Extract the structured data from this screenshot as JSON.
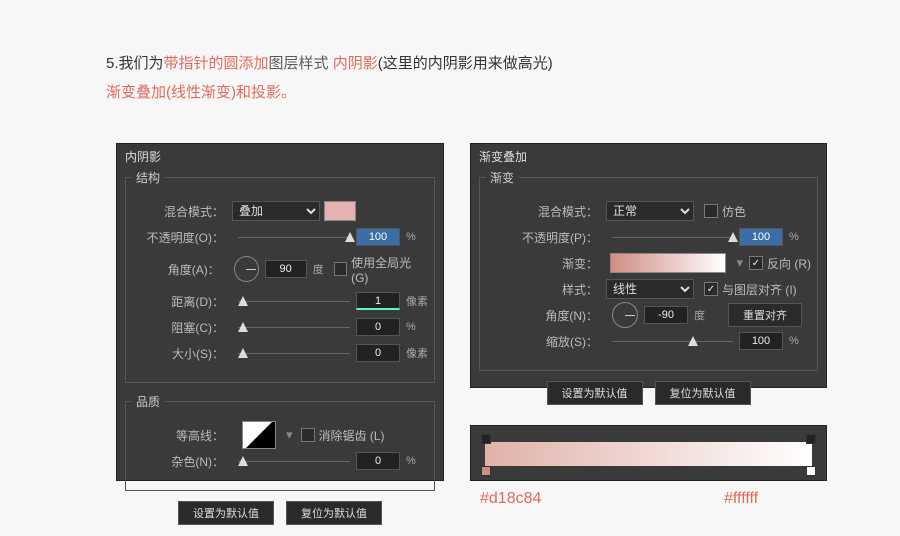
{
  "instruction": {
    "prefix": "5.我们为",
    "hl1": "带指针的圆添加",
    "mid1": "图层样式 ",
    "hl2": "内阴影",
    "mid2": "(这里的内阴影用来做高光)",
    "line2hl": "渐变叠加(线性渐变)和投影",
    "line2end": "。"
  },
  "left": {
    "title": "内阴影",
    "section_struct": "结构",
    "blend_label": "混合模式：",
    "blend_value": "叠加",
    "swatch_hex": "e6b1b1",
    "opacity_label": "不透明度(O)：",
    "opacity_value": "100",
    "opacity_unit": "%",
    "angle_label": "角度(A)：",
    "angle_value": "90",
    "angle_unit": "度",
    "global_light_label": "使用全局光 (G)",
    "distance_label": "距离(D)：",
    "distance_value": "1",
    "distance_unit": "像素",
    "choke_label": "阻塞(C)：",
    "choke_value": "0",
    "choke_unit": "%",
    "size_label": "大小(S)：",
    "size_value": "0",
    "size_unit": "像素",
    "section_quality": "品质",
    "contour_label": "等高线：",
    "antialias_label": "消除锯齿 (L)",
    "noise_label": "杂色(N)：",
    "noise_value": "0",
    "noise_unit": "%",
    "btn_default": "设置为默认值",
    "btn_reset": "复位为默认值"
  },
  "right": {
    "title": "渐变叠加",
    "section": "渐变",
    "blend_label": "混合模式：",
    "blend_value": "正常",
    "dither_label": "仿色",
    "opacity_label": "不透明度(P)：",
    "opacity_value": "100",
    "opacity_unit": "%",
    "gradient_label": "渐变：",
    "reverse_label": "反向 (R)",
    "style_label": "样式：",
    "style_value": "线性",
    "align_label": "与图层对齐 (I)",
    "angle_label": "角度(N)：",
    "angle_value": "-90",
    "angle_unit": "度",
    "reset_align": "重置对齐",
    "scale_label": "缩放(S)：",
    "scale_value": "100",
    "scale_unit": "%",
    "btn_default": "设置为默认值",
    "btn_reset": "复位为默认值"
  },
  "preview": {
    "stop1_hex": "#d18c84",
    "stop2_hex": "#ffffff"
  }
}
